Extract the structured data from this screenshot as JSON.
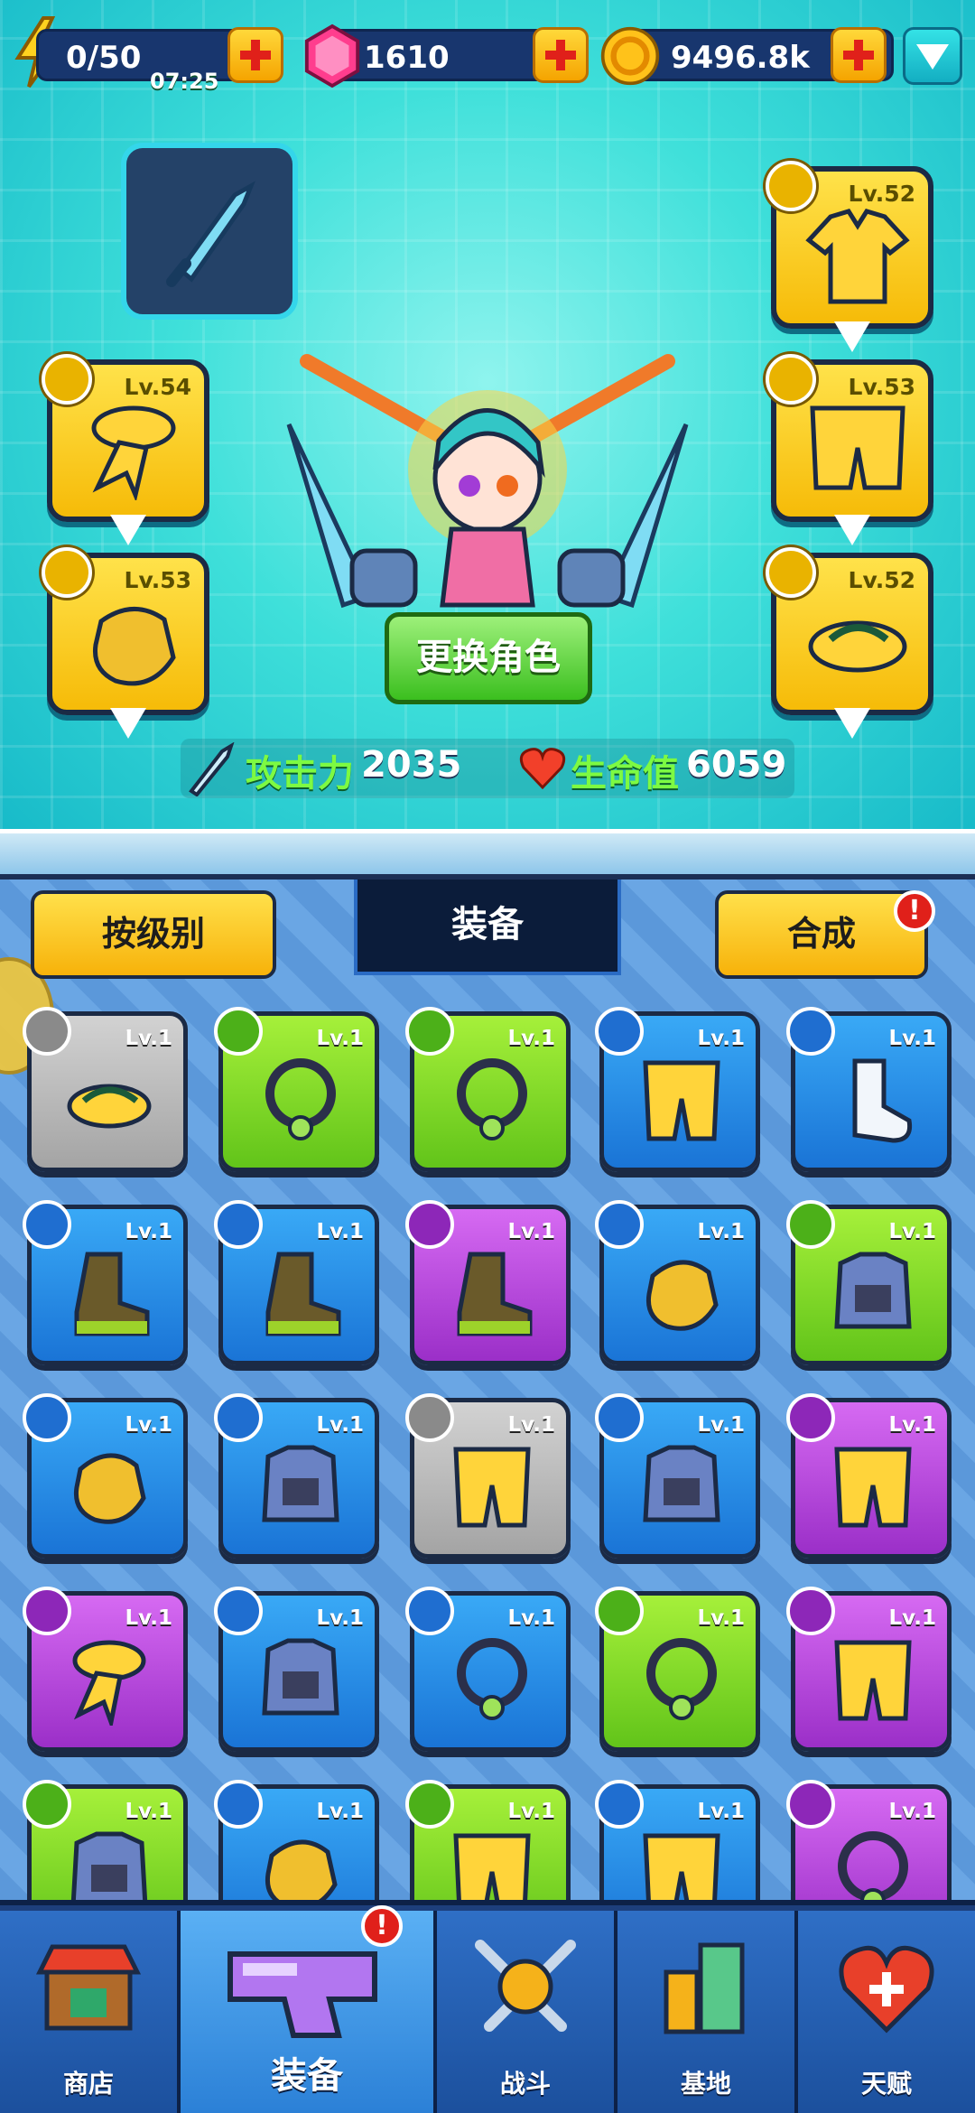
{
  "resources": {
    "energy": "0/50",
    "timer": "07:25",
    "gems": "1610",
    "coins": "9496.8k"
  },
  "equipped": {
    "weapon": {
      "name": "knife"
    },
    "shirt": {
      "level": "Lv.52"
    },
    "scarf": {
      "level": "Lv.54"
    },
    "pants": {
      "level": "Lv.53"
    },
    "gloves": {
      "level": "Lv.53"
    },
    "shoes": {
      "level": "Lv.52"
    }
  },
  "change_character": "更换角色",
  "stats": {
    "attack_label": "攻击力",
    "attack_value": "2035",
    "hp_label": "生命值",
    "hp_value": "6059"
  },
  "tabs": {
    "sort": "按级别",
    "equipment": "装备",
    "merge": "合成",
    "alert": "!"
  },
  "inventory": [
    {
      "level": "Lv.1",
      "rarity": "gray",
      "item": "shoes"
    },
    {
      "level": "Lv.1",
      "rarity": "green",
      "item": "necklace"
    },
    {
      "level": "Lv.1",
      "rarity": "green",
      "item": "necklace"
    },
    {
      "level": "Lv.1",
      "rarity": "blue",
      "item": "pants"
    },
    {
      "level": "Lv.1",
      "rarity": "blue",
      "item": "sock"
    },
    {
      "level": "Lv.1",
      "rarity": "blue",
      "item": "boots"
    },
    {
      "level": "Lv.1",
      "rarity": "blue",
      "item": "boots"
    },
    {
      "level": "Lv.1",
      "rarity": "purple",
      "item": "boots"
    },
    {
      "level": "Lv.1",
      "rarity": "blue",
      "item": "gloves"
    },
    {
      "level": "Lv.1",
      "rarity": "green",
      "item": "armor"
    },
    {
      "level": "Lv.1",
      "rarity": "blue",
      "item": "gloves"
    },
    {
      "level": "Lv.1",
      "rarity": "blue",
      "item": "armor"
    },
    {
      "level": "Lv.1",
      "rarity": "gray",
      "item": "pants"
    },
    {
      "level": "Lv.1",
      "rarity": "blue",
      "item": "armor"
    },
    {
      "level": "Lv.1",
      "rarity": "purple",
      "item": "pants"
    },
    {
      "level": "Lv.1",
      "rarity": "purple",
      "item": "scarf"
    },
    {
      "level": "Lv.1",
      "rarity": "blue",
      "item": "armor"
    },
    {
      "level": "Lv.1",
      "rarity": "blue",
      "item": "necklace"
    },
    {
      "level": "Lv.1",
      "rarity": "green",
      "item": "necklace"
    },
    {
      "level": "Lv.1",
      "rarity": "purple",
      "item": "pants"
    },
    {
      "level": "Lv.1",
      "rarity": "green",
      "item": "armor"
    },
    {
      "level": "Lv.1",
      "rarity": "blue",
      "item": "gloves"
    },
    {
      "level": "Lv.1",
      "rarity": "green",
      "item": "pants"
    },
    {
      "level": "Lv.1",
      "rarity": "blue",
      "item": "pants"
    },
    {
      "level": "Lv.1",
      "rarity": "purple",
      "item": "necklace"
    }
  ],
  "nav": [
    {
      "label": "商店",
      "icon": "shop-icon"
    },
    {
      "label": "装备",
      "icon": "equipment-icon"
    },
    {
      "label": "战斗",
      "icon": "battle-icon"
    },
    {
      "label": "基地",
      "icon": "base-icon"
    },
    {
      "label": "天赋",
      "icon": "talent-icon"
    }
  ],
  "colors": {
    "gray": "#b8b8b8",
    "green": "#7fd62a",
    "blue": "#2a8ae6",
    "purple": "#b445dc",
    "gold": "#f6c21a"
  }
}
